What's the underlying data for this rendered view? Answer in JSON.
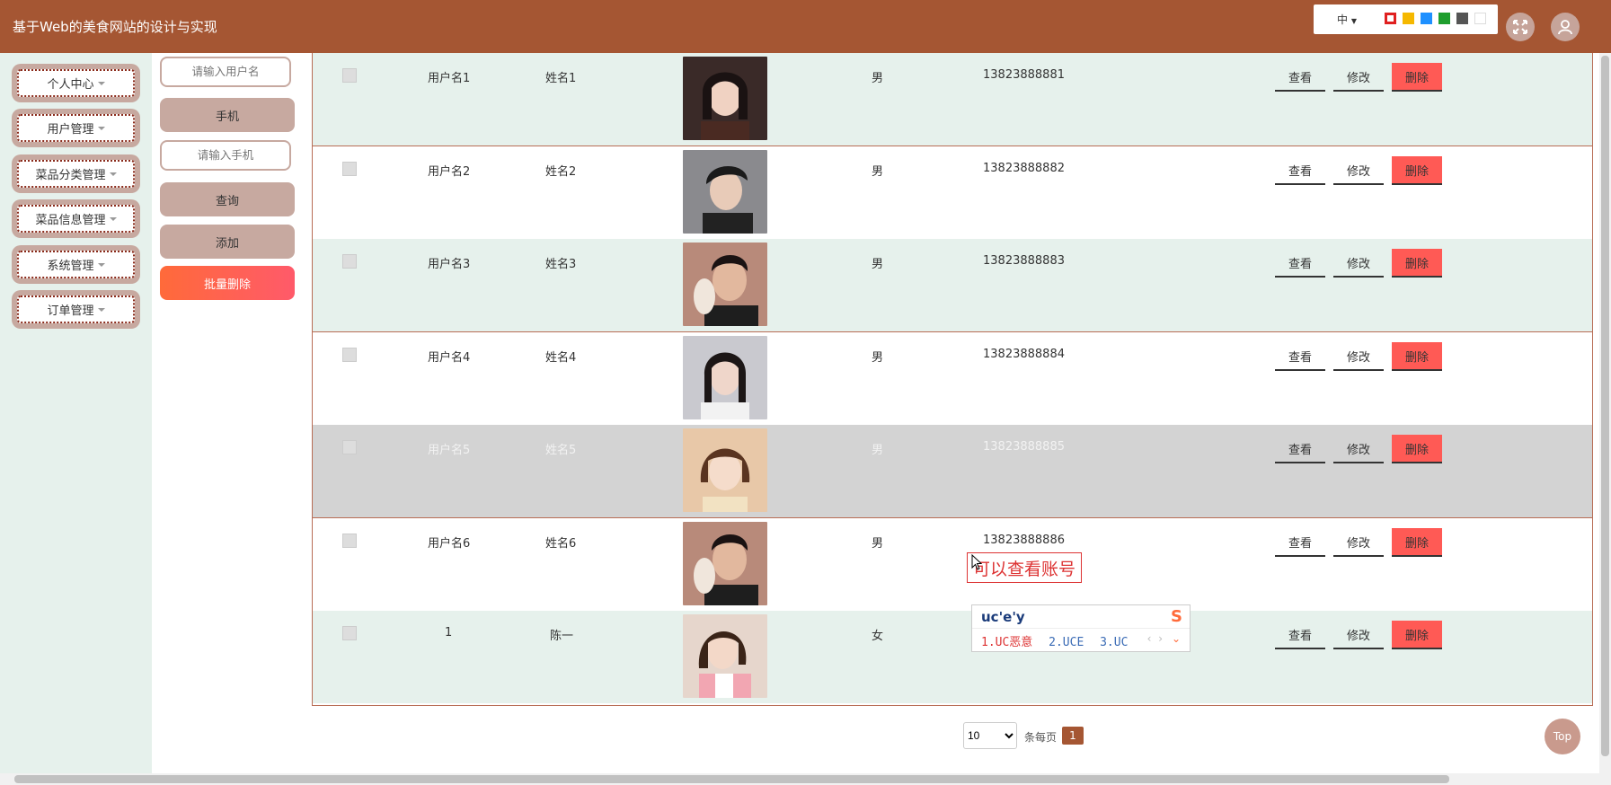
{
  "header": {
    "title": "基于Web的美食网站的设计与实现",
    "lang_label": "中",
    "theme_colors": [
      "#e02020",
      "#f5b800",
      "#1e90ff",
      "#1f9e2e",
      "#555555",
      "#ffffff"
    ]
  },
  "sidebar": {
    "items": [
      {
        "label": "个人中心"
      },
      {
        "label": "用户管理"
      },
      {
        "label": "菜品分类管理"
      },
      {
        "label": "菜品信息管理"
      },
      {
        "label": "系统管理"
      },
      {
        "label": "订单管理"
      }
    ]
  },
  "search": {
    "username_placeholder": "请输入用户名",
    "phone_label": "手机",
    "phone_placeholder": "请输入手机",
    "query_label": "查询",
    "add_label": "添加",
    "batch_delete_label": "批量删除"
  },
  "table": {
    "actions": {
      "view": "查看",
      "edit": "修改",
      "delete": "删除"
    },
    "rows": [
      {
        "username": "用户名1",
        "name": "姓名1",
        "gender": "男",
        "phone": "13823888881"
      },
      {
        "username": "用户名2",
        "name": "姓名2",
        "gender": "男",
        "phone": "13823888882"
      },
      {
        "username": "用户名3",
        "name": "姓名3",
        "gender": "男",
        "phone": "13823888883"
      },
      {
        "username": "用户名4",
        "name": "姓名4",
        "gender": "男",
        "phone": "13823888884"
      },
      {
        "username": "用户名5",
        "name": "姓名5",
        "gender": "男",
        "phone": "13823888885"
      },
      {
        "username": "用户名6",
        "name": "姓名6",
        "gender": "男",
        "phone": "13823888886"
      },
      {
        "username": "1",
        "name": "陈一",
        "gender": "女",
        "phone": ""
      }
    ]
  },
  "overlay": {
    "annotation": "可以查看账号",
    "ime_input": "uc'e'y",
    "ime_candidates": [
      "1.UC恶意",
      "2.UCE",
      "3.UC"
    ],
    "ime_logo": "S"
  },
  "pagination": {
    "page_size": "10",
    "page_size_options": [
      "10"
    ],
    "per_page_label": "条每页",
    "current_page": "1"
  },
  "top_button": "Top"
}
